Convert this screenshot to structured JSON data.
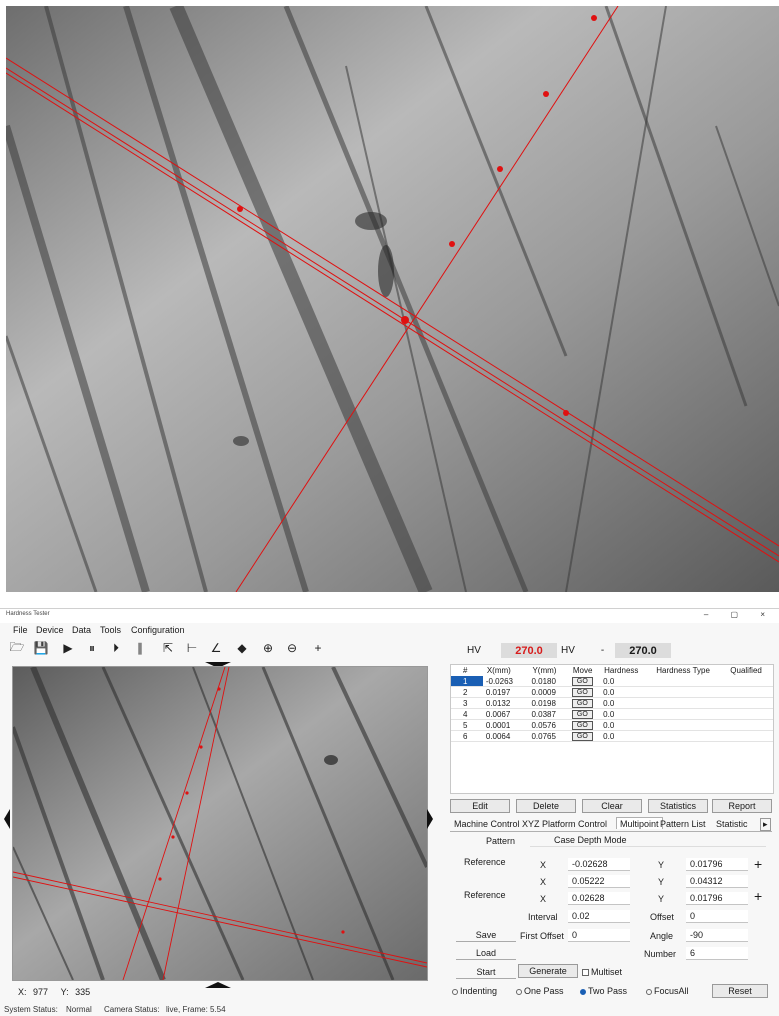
{
  "app": {
    "window_title": "Hardness Tester",
    "window_controls": "– ▢ ×",
    "menu": [
      "File",
      "Device",
      "Data",
      "Tools",
      "Configuration"
    ],
    "toolbar": [
      "folder-open-icon",
      "save-icon",
      "play-icon",
      "pause-icon",
      "step-icon",
      "stop-icon",
      "select-icon",
      "measure-line-icon",
      "angle-icon",
      "eraser-icon",
      "zoom-in-icon",
      "zoom-out-icon",
      "crosshair-icon"
    ]
  },
  "hv": {
    "label": "HV",
    "value": "270.0",
    "unit_select": "HV",
    "dash": "-",
    "value2": "270.0"
  },
  "points_table": {
    "headers": [
      "#",
      "X(mm)",
      "Y(mm)",
      "Move",
      "Hardness",
      "Hardness Type",
      "Qualified"
    ],
    "rows": [
      {
        "n": "1",
        "x": "-0.0263",
        "y": "0.0180",
        "move": "GO",
        "h": "0.0"
      },
      {
        "n": "2",
        "x": "0.0197",
        "y": "0.0009",
        "move": "GO",
        "h": "0.0"
      },
      {
        "n": "3",
        "x": "0.0132",
        "y": "0.0198",
        "move": "GO",
        "h": "0.0"
      },
      {
        "n": "4",
        "x": "0.0067",
        "y": "0.0387",
        "move": "GO",
        "h": "0.0"
      },
      {
        "n": "5",
        "x": "0.0001",
        "y": "0.0576",
        "move": "GO",
        "h": "0.0"
      },
      {
        "n": "6",
        "x": "0.0064",
        "y": "0.0765",
        "move": "GO",
        "h": "0.0"
      }
    ]
  },
  "table_buttons": [
    "Edit",
    "Delete",
    "Clear",
    "Statistics",
    "Report"
  ],
  "tabs": [
    "Machine Control",
    "XYZ Platform Control",
    "Multipoint",
    "Pattern List",
    "Statistic"
  ],
  "tab_scroll": "▸",
  "multipoint": {
    "pattern_label": "Pattern",
    "pattern_value": "Case Depth Mode",
    "reference_label": "Reference",
    "x_label": "X",
    "y_label": "Y",
    "ref1_x": "-0.02628",
    "ref1_y": "0.01796",
    "row2_x": "0.05222",
    "row2_y": "0.04312",
    "ref2_x": "0.02628",
    "ref2_y": "0.01796",
    "interval_label": "Interval",
    "interval": "0.02",
    "offset_label": "Offset",
    "offset": "0",
    "first_offset_label": "First Offset",
    "first_offset": "0",
    "angle_label": "Angle",
    "angle": "-90",
    "number_label": "Number",
    "number": "6",
    "save": "Save",
    "load": "Load",
    "start": "Start",
    "generate": "Generate",
    "multiset": "Multiset",
    "indenting": "Indenting",
    "one_pass": "One Pass",
    "two_pass": "Two Pass",
    "focus_all": "FocusAll",
    "reset": "Reset",
    "plus": "+"
  },
  "coords": {
    "x_label": "X:",
    "x": "977",
    "y_label": "Y:",
    "y": "335"
  },
  "status": {
    "system_label": "System Status:",
    "system": "Normal",
    "camera_label": "Camera Status:",
    "camera": "live, Frame: 5.54"
  },
  "colors": {
    "hv_value": "#d81b1b",
    "overlay_line": "#e01010",
    "accent": "#1a5fb4"
  }
}
